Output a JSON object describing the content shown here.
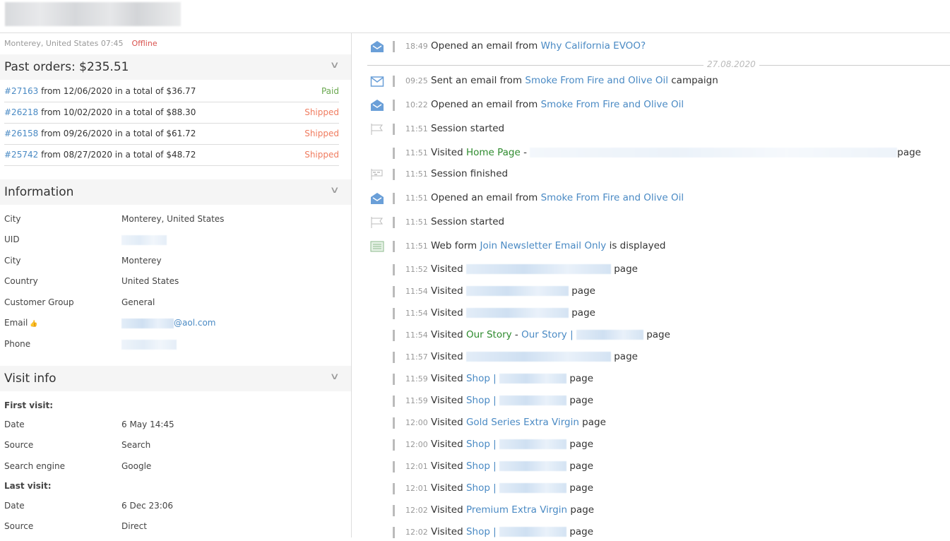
{
  "header": {
    "logo": "blurred-logo"
  },
  "customer": {
    "location": "Monterey, United States",
    "local_time": "07:45",
    "status": "Offline",
    "status_color": "#d9534f"
  },
  "orders": {
    "title": "Past orders: $235.51",
    "items": [
      {
        "id": "#27163",
        "text": "from 12/06/2020 in a total of $36.77",
        "status": "Paid",
        "color": "#6aa84f"
      },
      {
        "id": "#26218",
        "text": "from 10/02/2020 in a total of $88.30",
        "status": "Shipped",
        "color": "#f07c5f"
      },
      {
        "id": "#26158",
        "text": "from 09/26/2020 in a total of $61.72",
        "status": "Shipped",
        "color": "#f07c5f"
      },
      {
        "id": "#25742",
        "text": "from 08/27/2020 in a total of $48.72",
        "status": "Shipped",
        "color": "#f07c5f"
      }
    ]
  },
  "information": {
    "title": "Information",
    "rows": [
      {
        "label": "City",
        "value": "Monterey, United States"
      },
      {
        "label": "UID",
        "value": ""
      },
      {
        "label": "City",
        "value": "Monterey"
      },
      {
        "label": "Country",
        "value": "United States"
      },
      {
        "label": "Customer Group",
        "value": "General"
      },
      {
        "label": "Email",
        "value": "@aol.com"
      },
      {
        "label": "Phone",
        "value": ""
      }
    ]
  },
  "visit": {
    "title": "Visit info",
    "rows": [
      {
        "label": "First visit:",
        "value": "",
        "bold": true
      },
      {
        "label": "Date",
        "value": "6 May 14:45"
      },
      {
        "label": "Source",
        "value": "Search"
      },
      {
        "label": "Search engine",
        "value": "Google"
      },
      {
        "label": "Last visit:",
        "value": "",
        "bold": true
      },
      {
        "label": "Date",
        "value": "6 Dec 23:06"
      },
      {
        "label": "Source",
        "value": "Direct"
      }
    ]
  },
  "timeline": {
    "date_separator": "27.08.2020",
    "events": [
      {
        "icon": "email-opened-icon",
        "time": "18:49",
        "parts": [
          [
            "Opened an email from ",
            ""
          ],
          [
            "Why California EVOO?",
            "lk"
          ]
        ]
      },
      {
        "icon": "email-sent-icon",
        "time": "09:25",
        "parts": [
          [
            "Sent an email from ",
            ""
          ],
          [
            "Smoke From Fire and Olive Oil",
            "lk"
          ],
          [
            " campaign",
            ""
          ]
        ]
      },
      {
        "icon": "email-opened-icon",
        "time": "10:22",
        "parts": [
          [
            "Opened an email from ",
            ""
          ],
          [
            "Smoke From Fire and Olive Oil",
            "lk"
          ]
        ]
      },
      {
        "icon": "flag-icon",
        "time": "11:51",
        "parts": [
          [
            "Session started",
            ""
          ]
        ]
      },
      {
        "icon": "",
        "time": "11:51",
        "parts": [
          [
            "Visited ",
            ""
          ],
          [
            "Home Page",
            "gr"
          ],
          [
            " - ",
            ""
          ],
          [
            "",
            "blur:520"
          ],
          [
            "page",
            ""
          ]
        ]
      },
      {
        "icon": "checkered-flag-icon",
        "time": "11:51",
        "parts": [
          [
            "Session finished",
            ""
          ]
        ]
      },
      {
        "icon": "email-opened-icon",
        "time": "11:51",
        "parts": [
          [
            "Opened an email from ",
            ""
          ],
          [
            "Smoke From Fire and Olive Oil",
            "lk"
          ]
        ]
      },
      {
        "icon": "flag-icon",
        "time": "11:51",
        "parts": [
          [
            "Session started",
            ""
          ]
        ]
      },
      {
        "icon": "web-form-icon",
        "time": "11:51",
        "parts": [
          [
            "Web form ",
            ""
          ],
          [
            "Join Newsletter Email Only",
            "lk"
          ],
          [
            " is displayed",
            ""
          ]
        ]
      },
      {
        "icon": "",
        "time": "11:52",
        "parts": [
          [
            "Visited ",
            ""
          ],
          [
            "",
            "blur:205"
          ],
          [
            " page",
            ""
          ]
        ]
      },
      {
        "icon": "",
        "time": "11:54",
        "parts": [
          [
            "Visited ",
            ""
          ],
          [
            "",
            "blur:145"
          ],
          [
            " page",
            ""
          ]
        ]
      },
      {
        "icon": "",
        "time": "11:54",
        "parts": [
          [
            "Visited ",
            ""
          ],
          [
            "",
            "blur:145"
          ],
          [
            " page",
            ""
          ]
        ]
      },
      {
        "icon": "",
        "time": "11:54",
        "parts": [
          [
            "Visited ",
            ""
          ],
          [
            "Our Story",
            "gr"
          ],
          [
            " - ",
            ""
          ],
          [
            "Our Story | ",
            "lk"
          ],
          [
            "",
            "blur:95"
          ],
          [
            " page",
            ""
          ]
        ]
      },
      {
        "icon": "",
        "time": "11:57",
        "parts": [
          [
            "Visited ",
            ""
          ],
          [
            "",
            "blur:205"
          ],
          [
            " page",
            ""
          ]
        ]
      },
      {
        "icon": "",
        "time": "11:59",
        "parts": [
          [
            "Visited ",
            ""
          ],
          [
            "Shop | ",
            "lk"
          ],
          [
            "",
            "blur:95"
          ],
          [
            " page",
            ""
          ]
        ]
      },
      {
        "icon": "",
        "time": "11:59",
        "parts": [
          [
            "Visited ",
            ""
          ],
          [
            "Shop | ",
            "lk"
          ],
          [
            "",
            "blur:95"
          ],
          [
            " page",
            ""
          ]
        ]
      },
      {
        "icon": "",
        "time": "12:00",
        "parts": [
          [
            "Visited ",
            ""
          ],
          [
            "Gold Series Extra Virgin",
            "lk"
          ],
          [
            " page",
            ""
          ]
        ]
      },
      {
        "icon": "",
        "time": "12:00",
        "parts": [
          [
            "Visited ",
            ""
          ],
          [
            "Shop | ",
            "lk"
          ],
          [
            "",
            "blur:95"
          ],
          [
            " page",
            ""
          ]
        ]
      },
      {
        "icon": "",
        "time": "12:01",
        "parts": [
          [
            "Visited ",
            ""
          ],
          [
            "Shop | ",
            "lk"
          ],
          [
            "",
            "blur:95"
          ],
          [
            " page",
            ""
          ]
        ]
      },
      {
        "icon": "",
        "time": "12:01",
        "parts": [
          [
            "Visited ",
            ""
          ],
          [
            "Shop | ",
            "lk"
          ],
          [
            "",
            "blur:95"
          ],
          [
            " page",
            ""
          ]
        ]
      },
      {
        "icon": "",
        "time": "12:02",
        "parts": [
          [
            "Visited ",
            ""
          ],
          [
            "Premium Extra Virgin",
            "lk"
          ],
          [
            " page",
            ""
          ]
        ]
      },
      {
        "icon": "",
        "time": "12:02",
        "parts": [
          [
            "Visited ",
            ""
          ],
          [
            "Shop | ",
            "lk"
          ],
          [
            "",
            "blur:95"
          ],
          [
            " page",
            ""
          ]
        ]
      }
    ]
  }
}
